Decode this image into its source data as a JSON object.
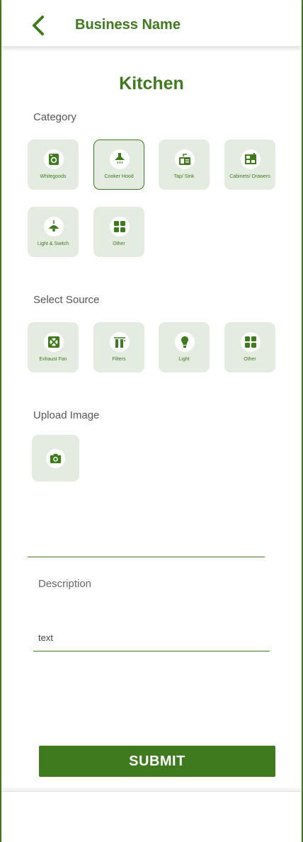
{
  "header": {
    "title": "Business Name",
    "back_icon": "chevron-left-icon"
  },
  "page_title": "Kitchen",
  "category": {
    "label": "Category",
    "items": [
      {
        "label": "Whitegoods",
        "icon": "washing-machine-icon",
        "selected": false
      },
      {
        "label": "Cooker Hood",
        "icon": "cooker-hood-icon",
        "selected": true
      },
      {
        "label": "Tap/ Sink",
        "icon": "sink-icon",
        "selected": false
      },
      {
        "label": "Cabinets/ Drawers",
        "icon": "cabinet-icon",
        "selected": false
      },
      {
        "label": "Light & Switch",
        "icon": "pendant-light-icon",
        "selected": false
      },
      {
        "label": "Other",
        "icon": "grid-icon",
        "selected": false
      }
    ]
  },
  "source": {
    "label": "Select Source",
    "items": [
      {
        "label": "Exhaust Fan",
        "icon": "fan-icon"
      },
      {
        "label": "Filters",
        "icon": "filter-icon"
      },
      {
        "label": "Light",
        "icon": "bulb-icon"
      },
      {
        "label": "Other",
        "icon": "grid-icon"
      }
    ]
  },
  "upload": {
    "label": "Upload Image",
    "icon": "camera-icon"
  },
  "description": {
    "label": "Description",
    "value": "text"
  },
  "submit_label": "SUBMIT",
  "colors": {
    "accent": "#3f7a1e",
    "tile_bg": "#e4ebe0"
  }
}
